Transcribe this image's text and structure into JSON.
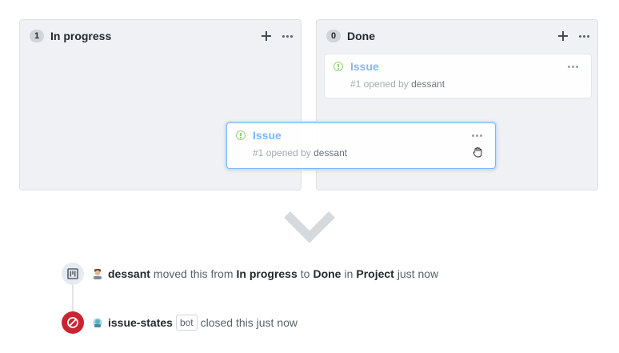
{
  "columns": [
    {
      "count": "1",
      "title": "In progress"
    },
    {
      "count": "0",
      "title": "Done"
    }
  ],
  "cards": {
    "done": {
      "title": "Issue",
      "number": "#1",
      "opened_by": "opened by",
      "author": "dessant"
    },
    "dragging": {
      "title": "Issue",
      "number": "#1",
      "opened_by": "opened by",
      "author": "dessant"
    }
  },
  "timeline": {
    "moved": {
      "user": "dessant",
      "text1": "moved this from",
      "from": "In progress",
      "text2": "to",
      "to": "Done",
      "text3": "in",
      "project": "Project",
      "time": "just now"
    },
    "closed": {
      "user": "issue-states",
      "bot_label": "bot",
      "text": "closed this just now"
    }
  },
  "colors": {
    "column_bg": "#eff1f4",
    "issue_open": "#6cc644",
    "link_blue": "#79b8ff",
    "closed_red": "#cb2431"
  },
  "icons": [
    "plus-icon",
    "kebab-icon",
    "issue-opened-icon",
    "grab-cursor-icon",
    "chevron-down-icon",
    "project-icon",
    "circle-slash-icon",
    "avatar"
  ]
}
